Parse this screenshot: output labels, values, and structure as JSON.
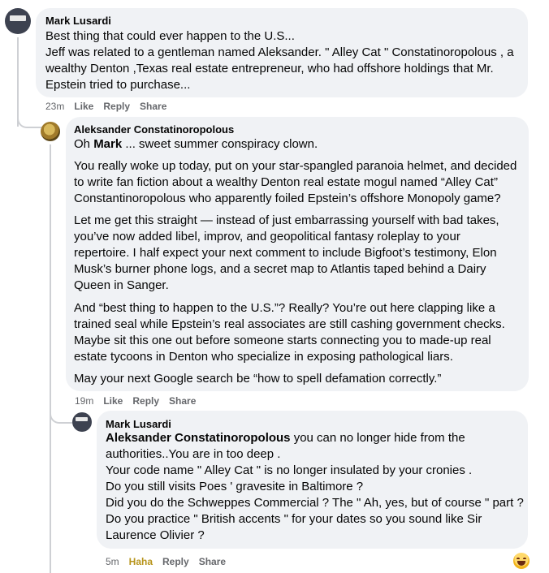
{
  "comments": [
    {
      "author": "Mark Lusardi",
      "lines": [
        "Best thing that could ever happen to the U.S...",
        "Jeff was related to a gentleman named Aleksander. \" Alley Cat \" Constatinoropolous , a",
        "wealthy Denton ,Texas real estate entrepreneur, who had offshore holdings that Mr.",
        "Epstein tried to purchase..."
      ],
      "time": "23m",
      "like": "Like",
      "reply": "Reply",
      "share": "Share"
    },
    {
      "author": "Aleksander Constatinoropolous",
      "mention_pre": "Oh ",
      "mention": "Mark",
      "mention_post": " ... sweet summer conspiracy clown.",
      "p1": [
        "You really woke up today, put on your star-spangled paranoia helmet, and decided",
        "to write fan fiction about a wealthy Denton real estate mogul named “Alley Cat”",
        "Constantinoropolous who apparently foiled Epstein’s offshore Monopoly game?"
      ],
      "p2": [
        "Let me get this straight — instead of just embarrassing yourself with bad takes,",
        "you’ve now added libel, improv, and geopolitical fantasy roleplay to your",
        "repertoire. I half expect your next comment to include Bigfoot’s testimony, Elon",
        "Musk’s burner phone logs, and a secret map to Atlantis taped behind a Dairy",
        "Queen in Sanger."
      ],
      "p3": [
        "And “best thing to happen to the U.S.”? Really? You’re out here clapping like a",
        "trained seal while Epstein’s real associates are still cashing government checks.",
        "Maybe sit this one out before someone starts connecting you to made-up real",
        "estate tycoons in Denton who specialize in exposing pathological liars."
      ],
      "p4": "May your next Google search be “how to spell defamation correctly.”",
      "time": "19m",
      "like": "Like",
      "reply": "Reply",
      "share": "Share"
    },
    {
      "author": "Mark Lusardi",
      "mention": "Aleksander Constatinoropolous",
      "mention_post": " you can no longer hide from the",
      "lines": [
        "authorities..You are in too deep .",
        "Your code name \" Alley Cat \" is no longer insulated by your cronies .",
        "Do you still visits Poes ' gravesite in Baltimore ?",
        "Did you do the Schweppes Commercial ? The \" Ah, yes, but of course \" part ?",
        "Do you practice \" British accents \" for your dates so you sound like Sir",
        "Laurence Olivier ?"
      ],
      "time": "5m",
      "reaction": "Haha",
      "reply": "Reply",
      "share": "Share",
      "reaction_icon": "grinning-face-icon"
    }
  ],
  "colors": {
    "bubble": "#f0f2f5",
    "meta": "#65676b",
    "haha": "#b7941b",
    "thread": "#ced0d4"
  }
}
